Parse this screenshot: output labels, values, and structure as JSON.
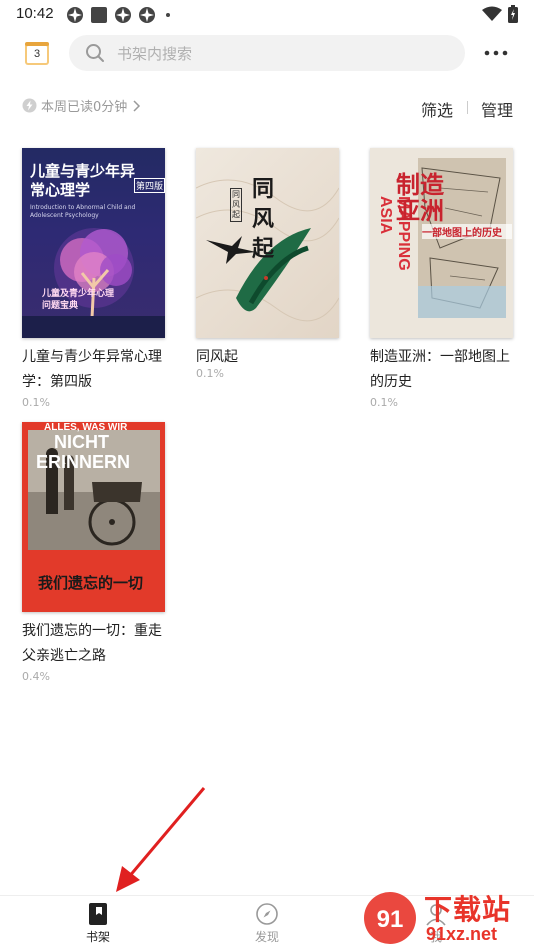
{
  "status_bar": {
    "time": "10:42"
  },
  "header": {
    "calendar_day": "3",
    "search_placeholder": "书架内搜索"
  },
  "shelf_bar": {
    "read_summary": "本周已读0分钟",
    "filter_label": "筛选",
    "manage_label": "管理"
  },
  "books": [
    {
      "title": "儿童与青少年异常心理学：第四版",
      "progress": "0.1%",
      "cover": {
        "title": "儿童与青少年异常心理学",
        "edition": "第四版",
        "english": "Introduction to Abnormal Child and Adolescent Psychology",
        "tagline": "儿童及青少年心理问题宝典"
      }
    },
    {
      "title": "同风起",
      "progress": "0.1%",
      "cover": {
        "title": "同风起",
        "small": "同风起"
      }
    },
    {
      "title": "制造亚洲：一部地图上的历史",
      "progress": "0.1%",
      "cover": {
        "title": "制造亚洲",
        "english": "MAPPING ASIA",
        "subtitle": "一部地图上的历史"
      }
    },
    {
      "title": "我们遗忘的一切：重走父亲逃亡之路",
      "progress": "0.4%",
      "cover": {
        "title": "我们遗忘的一切",
        "german_line1": "ALLES, WAS WIR",
        "german_line2": "NICHT",
        "german_line3": "ERINNERN"
      }
    }
  ],
  "bottom_nav": {
    "items": [
      {
        "label": "书架",
        "active": true
      },
      {
        "label": "发现",
        "active": false
      },
      {
        "label": "我",
        "active": false
      }
    ]
  },
  "watermark": {
    "brand": "下载站",
    "url": "91xz.net",
    "logo": "91"
  },
  "colors": {
    "active": "#222222",
    "inactive": "#999999",
    "accent_red": "#d32f2f"
  },
  "annotation": {
    "type": "red-arrow",
    "target": "书架"
  }
}
